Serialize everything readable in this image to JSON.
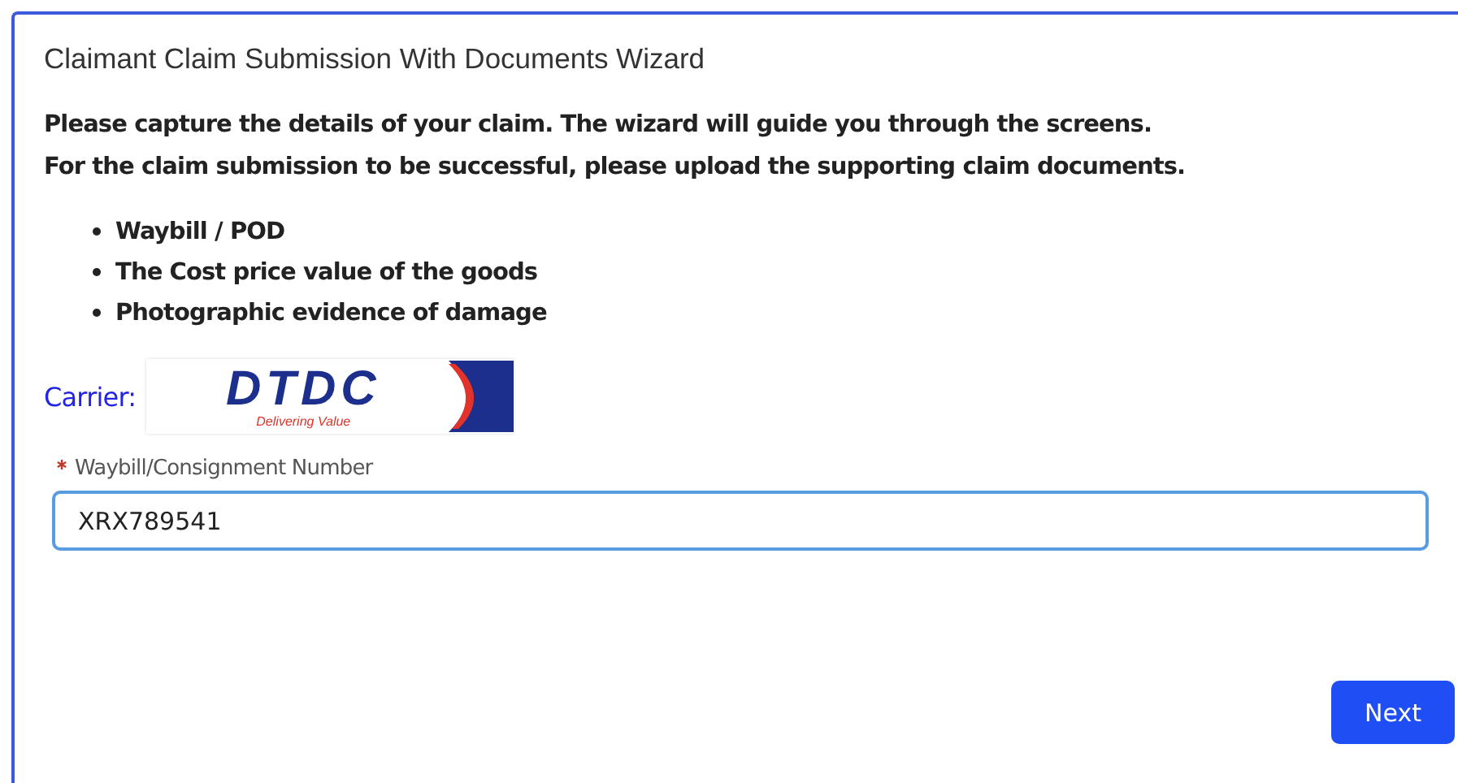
{
  "wizard": {
    "title": "Claimant Claim Submission With Documents Wizard",
    "intro": [
      "Please capture the details of your claim. The wizard will guide you through the screens.",
      "For the claim submission to be successful, please upload the supporting claim documents."
    ],
    "documents": [
      "Waybill / POD",
      "The Cost price value of the goods",
      "Photographic evidence of damage"
    ],
    "carrier": {
      "label": "Carrier:",
      "logo": {
        "name": "DTDC",
        "tagline": "Delivering Value"
      }
    },
    "field": {
      "label": "Waybill/Consignment Number",
      "required": true,
      "value": "XRX789541"
    },
    "buttons": [
      "Next"
    ]
  }
}
